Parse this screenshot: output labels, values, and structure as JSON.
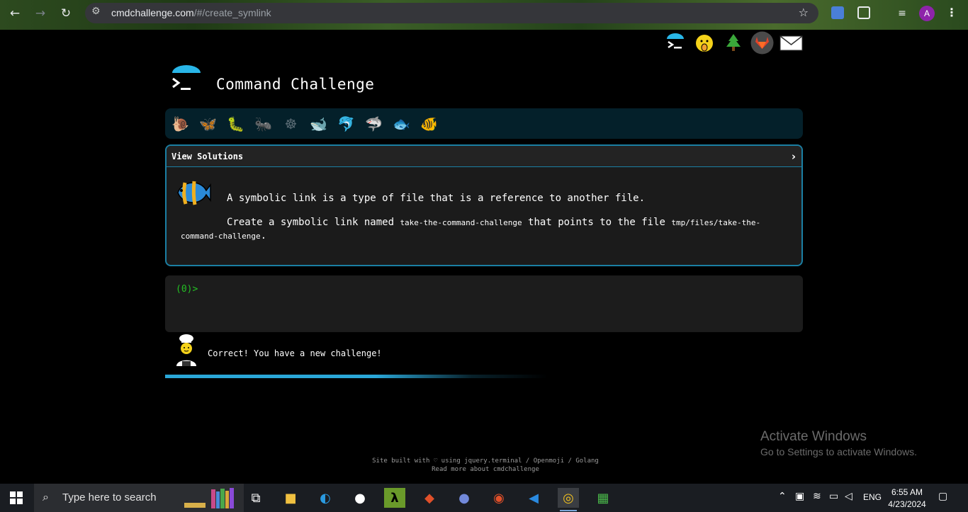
{
  "browser": {
    "url_host": "cmdchallenge.com",
    "url_path": "/#/create_symlink",
    "profile_initial": "A",
    "icons": [
      "back-icon",
      "forward-icon",
      "reload-icon",
      "site-settings-icon",
      "bookmark-star-icon",
      "translate-extension-icon",
      "extensions-puzzle-icon",
      "media-control-icon",
      "menu-dots-icon"
    ]
  },
  "top_links": [
    {
      "name": "cmdchallenge-home-icon",
      "glyph": "▶"
    },
    {
      "name": "oops-face-icon",
      "glyph": "😯"
    },
    {
      "name": "tree-icon",
      "glyph": "🌲"
    },
    {
      "name": "gitlab-icon",
      "glyph": "🦊"
    },
    {
      "name": "email-icon",
      "glyph": "✉"
    }
  ],
  "header": {
    "title": "Command Challenge"
  },
  "levels": [
    {
      "name": "snail-icon",
      "glyph": "🐌",
      "color": "#7a5a2a"
    },
    {
      "name": "butterfly-icon",
      "glyph": "🦋",
      "color": "#c97a2a"
    },
    {
      "name": "caterpillar-icon",
      "glyph": "🐛",
      "color": "#4a9a2a"
    },
    {
      "name": "ant-icon",
      "glyph": "🐜",
      "color": "#6b3a1a"
    },
    {
      "name": "ship-wheel-icon",
      "glyph": "☸",
      "color": "#5a6b74"
    },
    {
      "name": "whale-icon",
      "glyph": "🐋",
      "color": "#3b6a8a"
    },
    {
      "name": "dolphin-icon",
      "glyph": "🐬",
      "color": "#3b6a8a"
    },
    {
      "name": "shark-icon",
      "glyph": "🦈",
      "color": "#4a5a6a"
    },
    {
      "name": "fish-icon",
      "glyph": "🐟",
      "color": "#4a8ab8"
    },
    {
      "name": "tropical-fish-icon",
      "glyph": "🐠",
      "color": "#e0a020"
    }
  ],
  "card": {
    "header_label": "View Solutions",
    "description_1": "A symbolic link is a type of file that is a reference to another file.",
    "description_2_before": "Create a symbolic link named ",
    "link_name": "take-the-command-challenge",
    "description_2_middle": " that points to the file ",
    "target_path": "tmp/files/take-the-command-challenge",
    "description_2_after": "."
  },
  "terminal": {
    "prompt": "(0)>"
  },
  "status": {
    "message": "Correct! You have a new challenge!",
    "progress_fraction": 0.55
  },
  "footer": {
    "line1": "Site built with ♡ using jquery.terminal / Openmoji / Golang",
    "line2": "Read more about cmdchallenge"
  },
  "watermark": {
    "title": "Activate Windows",
    "subtitle": "Go to Settings to activate Windows."
  },
  "taskbar": {
    "search_placeholder": "Type here to search",
    "apps": [
      "task-view-icon",
      "file-explorer-icon",
      "edge-icon",
      "github-desktop-icon",
      "lambda-app-icon",
      "git-icon",
      "discord-icon",
      "ubuntu-icon",
      "vscode-icon",
      "chrome-icon",
      "notepad-icon"
    ],
    "language": "ENG",
    "time": "6:55 AM",
    "date": "4/23/2024"
  }
}
